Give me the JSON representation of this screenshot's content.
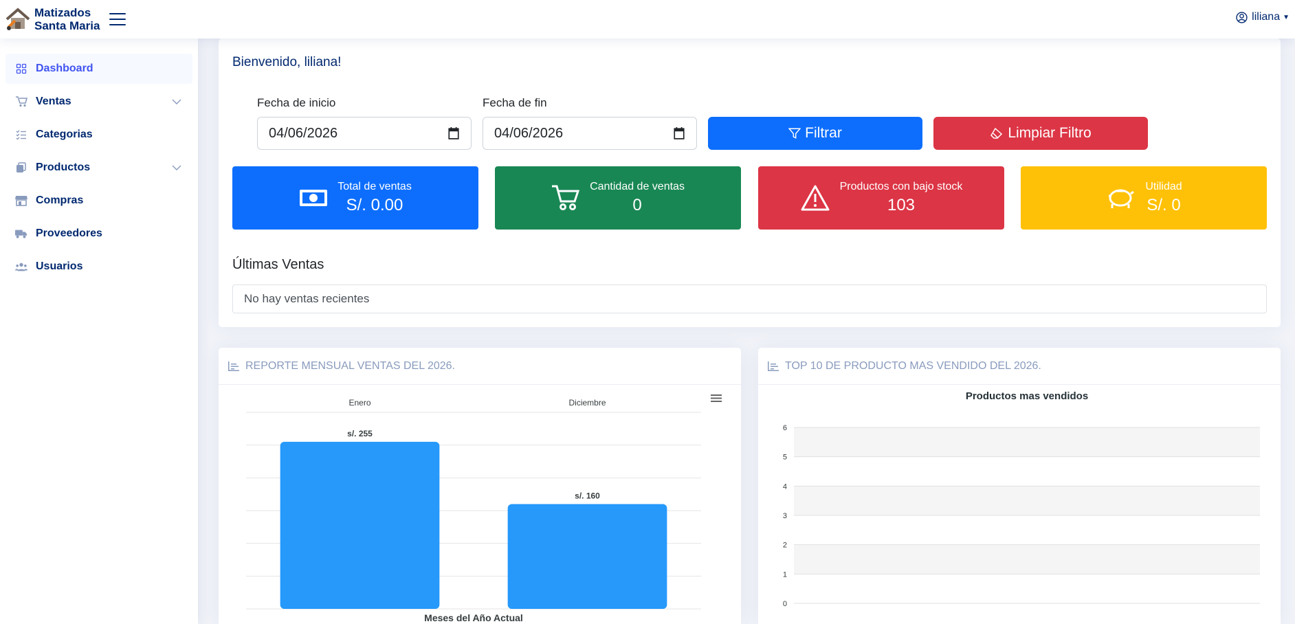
{
  "brand": {
    "name_line1": "Matizados",
    "name_line2": "Santa Maria"
  },
  "user": {
    "name": "liliana"
  },
  "sidebar": {
    "items": [
      {
        "label": "Dashboard",
        "icon": "grid-icon",
        "active": true
      },
      {
        "label": "Ventas",
        "icon": "cart-icon",
        "has_submenu": true
      },
      {
        "label": "Categorias",
        "icon": "list-check-icon"
      },
      {
        "label": "Productos",
        "icon": "copy-icon",
        "has_submenu": true
      },
      {
        "label": "Compras",
        "icon": "shop-icon"
      },
      {
        "label": "Proveedores",
        "icon": "truck-icon"
      },
      {
        "label": "Usuarios",
        "icon": "users-icon"
      }
    ]
  },
  "welcome": "Bienvenido, liliana!",
  "filters": {
    "start_label": "Fecha de inicio",
    "start_value": "04/06/2026",
    "end_label": "Fecha de fin",
    "end_value": "04/06/2026",
    "filter_button": "Filtrar",
    "clear_button": "Limpiar Filtro"
  },
  "stats": [
    {
      "title": "Total de ventas",
      "value": "S/. 0.00",
      "icon": "cash-icon",
      "color": "#0d6efd"
    },
    {
      "title": "Cantidad de ventas",
      "value": "0",
      "icon": "cart-icon",
      "color": "#198754"
    },
    {
      "title": "Productos con bajo stock",
      "value": "103",
      "icon": "warning-icon",
      "color": "#dc3545"
    },
    {
      "title": "Utilidad",
      "value": "S/. 0",
      "icon": "piggy-bank-icon",
      "color": "#ffc107"
    }
  ],
  "recent_sales": {
    "title": "Últimas Ventas",
    "empty_message": "No hay ventas recientes"
  },
  "monthly_report": {
    "header": "REPORTE MENSUAL VENTAS DEL 2026."
  },
  "top_products": {
    "header": "TOP 10 DE PRODUCTO MAS VENDIDO DEL 2026."
  },
  "chart_data": [
    {
      "type": "bar",
      "categories": [
        "Enero",
        "Diciembre"
      ],
      "values": [
        255,
        160
      ],
      "data_labels": [
        "s/. 255",
        "s/. 160"
      ],
      "xlabel": "Meses del Año Actual",
      "ylim": [
        0,
        300
      ],
      "grid": true,
      "color": "#2699fb"
    },
    {
      "type": "bar",
      "title": "Productos mas vendidos",
      "categories": [],
      "values": [],
      "yticks": [
        0,
        1,
        2,
        3,
        4,
        5,
        6
      ],
      "ylim": [
        0,
        6
      ],
      "grid": true
    }
  ]
}
